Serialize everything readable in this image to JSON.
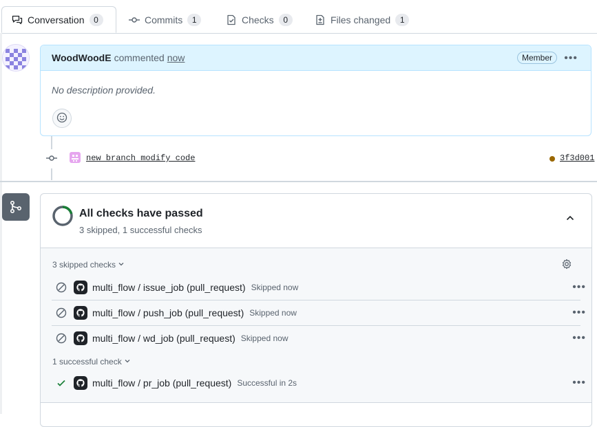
{
  "tabs": [
    {
      "label": "Conversation",
      "count": "0",
      "icon": "conversation-icon"
    },
    {
      "label": "Commits",
      "count": "1",
      "icon": "git-commit-icon"
    },
    {
      "label": "Checks",
      "count": "0",
      "icon": "checklist-icon"
    },
    {
      "label": "Files changed",
      "count": "1",
      "icon": "file-diff-icon"
    }
  ],
  "comment": {
    "author": "WoodWoodE",
    "action": "commented",
    "time": "now",
    "badge": "Member",
    "body": "No description provided."
  },
  "commit": {
    "message": "new branch modify code",
    "sha": "3f3d001",
    "status_color": "#9a6700"
  },
  "checks": {
    "title": "All checks have passed",
    "subtitle": "3 skipped, 1 successful checks",
    "skipped_group": "3 skipped checks",
    "success_group": "1 successful check",
    "skipped": [
      {
        "name": "multi_flow / issue_job (pull_request)",
        "status": "Skipped now"
      },
      {
        "name": "multi_flow / push_job (pull_request)",
        "status": "Skipped now"
      },
      {
        "name": "multi_flow / wd_job (pull_request)",
        "status": "Skipped now"
      }
    ],
    "successful": [
      {
        "name": "multi_flow / pr_job (pull_request)",
        "status": "Successful in 2s"
      }
    ]
  },
  "colors": {
    "success": "#1a7f37",
    "comment_header": "#ddf4ff",
    "border": "#d0d7de"
  }
}
